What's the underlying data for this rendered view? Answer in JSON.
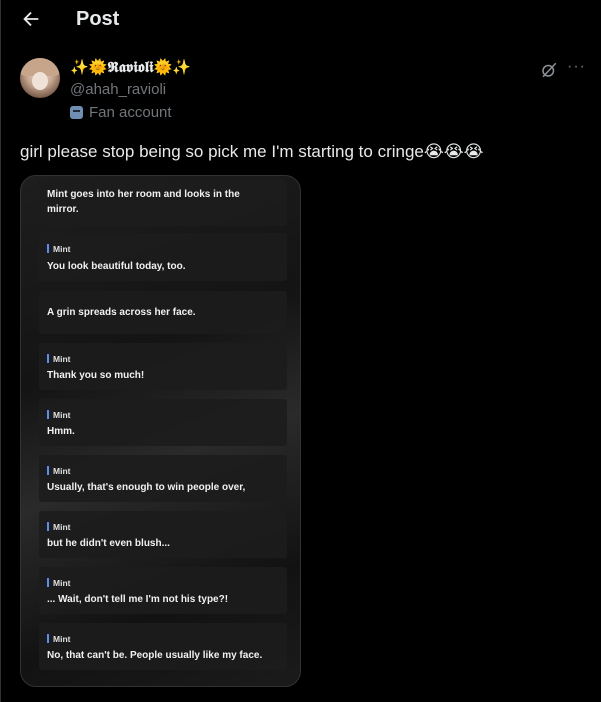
{
  "header": {
    "title": "Post",
    "back_icon": "back-arrow-icon"
  },
  "author": {
    "display_name": "✨🌞𝕽𝖆𝖛𝖎𝖔𝖑𝖎🌞✨",
    "handle": "@ahah_ravioli",
    "badge": "Fan account",
    "badge_icon": "mask-icon"
  },
  "actions": {
    "more": "···",
    "grok_icon": "grok-icon"
  },
  "post": {
    "text": "girl please stop being so pick me I'm starting to cringe😭😭😭"
  },
  "media": {
    "messages": [
      {
        "speaker": "",
        "text": "Mint goes into her room and looks in the mirror."
      },
      {
        "speaker": "Mint",
        "text": "You look beautiful today, too."
      },
      {
        "speaker": "",
        "text": "A grin spreads across her face."
      },
      {
        "speaker": "Mint",
        "text": "Thank you so much!"
      },
      {
        "speaker": "Mint",
        "text": "Hmm."
      },
      {
        "speaker": "Mint",
        "text": "Usually, that's enough to win people over,"
      },
      {
        "speaker": "Mint",
        "text": "but he didn't even blush..."
      },
      {
        "speaker": "Mint",
        "text": "... Wait, don't tell me I'm not his type?!"
      },
      {
        "speaker": "Mint",
        "text": "No, that can't be. People usually like my face."
      }
    ]
  }
}
